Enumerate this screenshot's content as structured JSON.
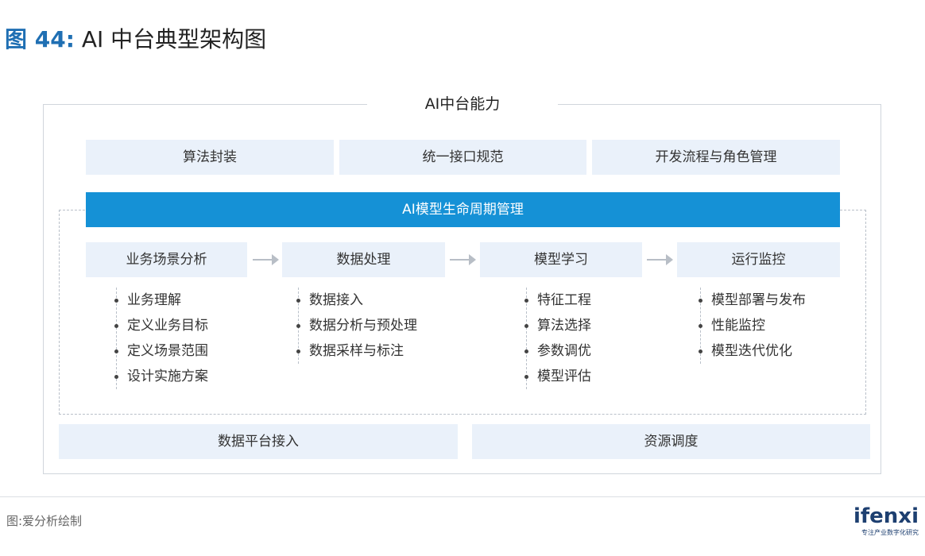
{
  "figure": {
    "number": "图 44:",
    "title": "AI 中台典型架构图"
  },
  "capability": {
    "title": "AI中台能力",
    "items": [
      "算法封装",
      "统一接口规范",
      "开发流程与角色管理"
    ]
  },
  "lifecycle": {
    "title": "AI模型生命周期管理",
    "stages": [
      {
        "label": "业务场景分析",
        "tasks": [
          "业务理解",
          "定义业务目标",
          "定义场景范围",
          "设计实施方案"
        ]
      },
      {
        "label": "数据处理",
        "tasks": [
          "数据接入",
          "数据分析与预处理",
          "数据采样与标注"
        ]
      },
      {
        "label": "模型学习",
        "tasks": [
          "特征工程",
          "算法选择",
          "参数调优",
          "模型评估"
        ]
      },
      {
        "label": "运行监控",
        "tasks": [
          "模型部署与发布",
          "性能监控",
          "模型迭代优化"
        ]
      }
    ]
  },
  "foundation": {
    "items": [
      "数据平台接入",
      "资源调度"
    ]
  },
  "footer": {
    "source": "图:爱分析绘制",
    "logo_text": "ifenxi",
    "logo_tagline": "专注产业数字化研究"
  },
  "colors": {
    "accent": "#1591d6",
    "box_fill": "#eaf1fa",
    "title_blue": "#1f6fb3",
    "logo_navy": "#1d3f70"
  }
}
